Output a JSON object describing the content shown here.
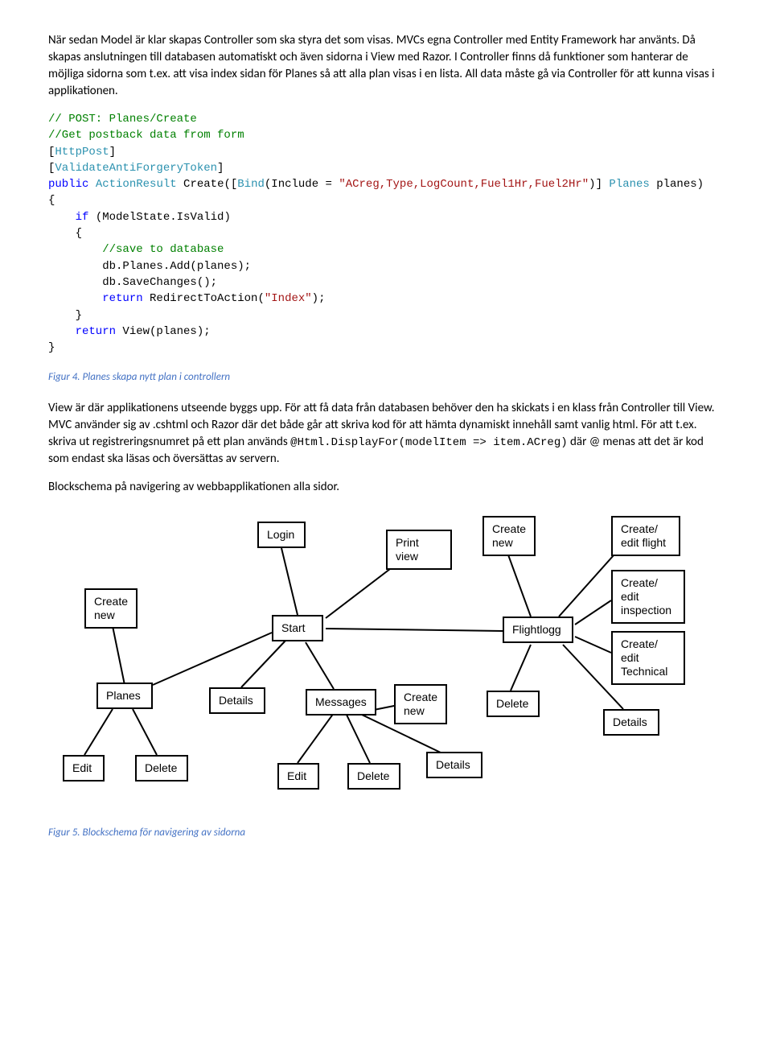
{
  "para1": "När sedan Model är klar skapas Controller som ska styra det som visas. MVCs egna Controller med Entity Framework har använts. Då skapas anslutningen till databasen automatiskt och även sidorna i View med Razor. I Controller finns då funktioner som hanterar de möjliga sidorna som t.ex. att visa index sidan för Planes så att alla plan visas i en lista. All data måste gå via Controller för att kunna visas i applikationen.",
  "code": {
    "l1": "// POST: Planes/Create",
    "l2": "//Get postback data from form",
    "l3a": "[",
    "l3b": "HttpPost",
    "l3c": "]",
    "l4a": "[",
    "l4b": "ValidateAntiForgeryToken",
    "l4c": "]",
    "l5a": "public",
    "l5b": " ",
    "l5c": "ActionResult",
    "l5d": " Create([",
    "l5e": "Bind",
    "l5f": "(Include = ",
    "l5g": "\"ACreg,Type,LogCount,Fuel1Hr,Fuel2Hr\"",
    "l5h": ")] ",
    "l5i": "Planes",
    "l5j": " planes)",
    "l6": "{",
    "l7a": "    if",
    "l7b": " (ModelState.IsValid)",
    "l8": "    {",
    "l9": "        //save to database",
    "l10": "        db.Planes.Add(planes);",
    "l11": "        db.SaveChanges();",
    "l12a": "        return",
    "l12b": " RedirectToAction(",
    "l12c": "\"Index\"",
    "l12d": ");",
    "l13": "    }",
    "l14a": "    return",
    "l14b": " View(planes);",
    "l15": "}"
  },
  "caption1": "Figur 4. Planes skapa nytt plan i controllern",
  "para2_part1": "View är där applikationens utseende byggs upp. För att få data från databasen behöver den ha skickats i en klass från Controller till View.  MVC använder sig av .cshtml och Razor där det både går att skriva kod för att hämta dynamiskt innehåll samt vanlig html. För att t.ex. skriva ut registreringsnumret på ett plan används ",
  "para2_code": "@Html.DisplayFor(modelItem => item.ACreg)",
  "para2_part2": " där @ menas att det är kod som endast ska läsas och översättas av servern.",
  "para3": "Blockschema på navigering av webbapplikationen alla sidor.",
  "diagram": {
    "login": "Login",
    "printview": "Print view",
    "createnew_top": "Create\nnew",
    "createeditflight": "Create/\nedit flight",
    "createnew_left": "Create\nnew",
    "start": "Start",
    "flightlogg": "Flightlogg",
    "createeditinspection": "Create/\nedit\ninspection",
    "createedittechnical": "Create/\nedit\nTechnical",
    "planes": "Planes",
    "details_mid": "Details",
    "messages": "Messages",
    "createnew_mid": "Create\nnew",
    "delete_mid": "Delete",
    "details_right": "Details",
    "edit_bl": "Edit",
    "delete_bl": "Delete",
    "edit_bm": "Edit",
    "delete_bm": "Delete",
    "details_bm": "Details"
  },
  "caption2": "Figur 5. Blockschema för navigering av sidorna"
}
